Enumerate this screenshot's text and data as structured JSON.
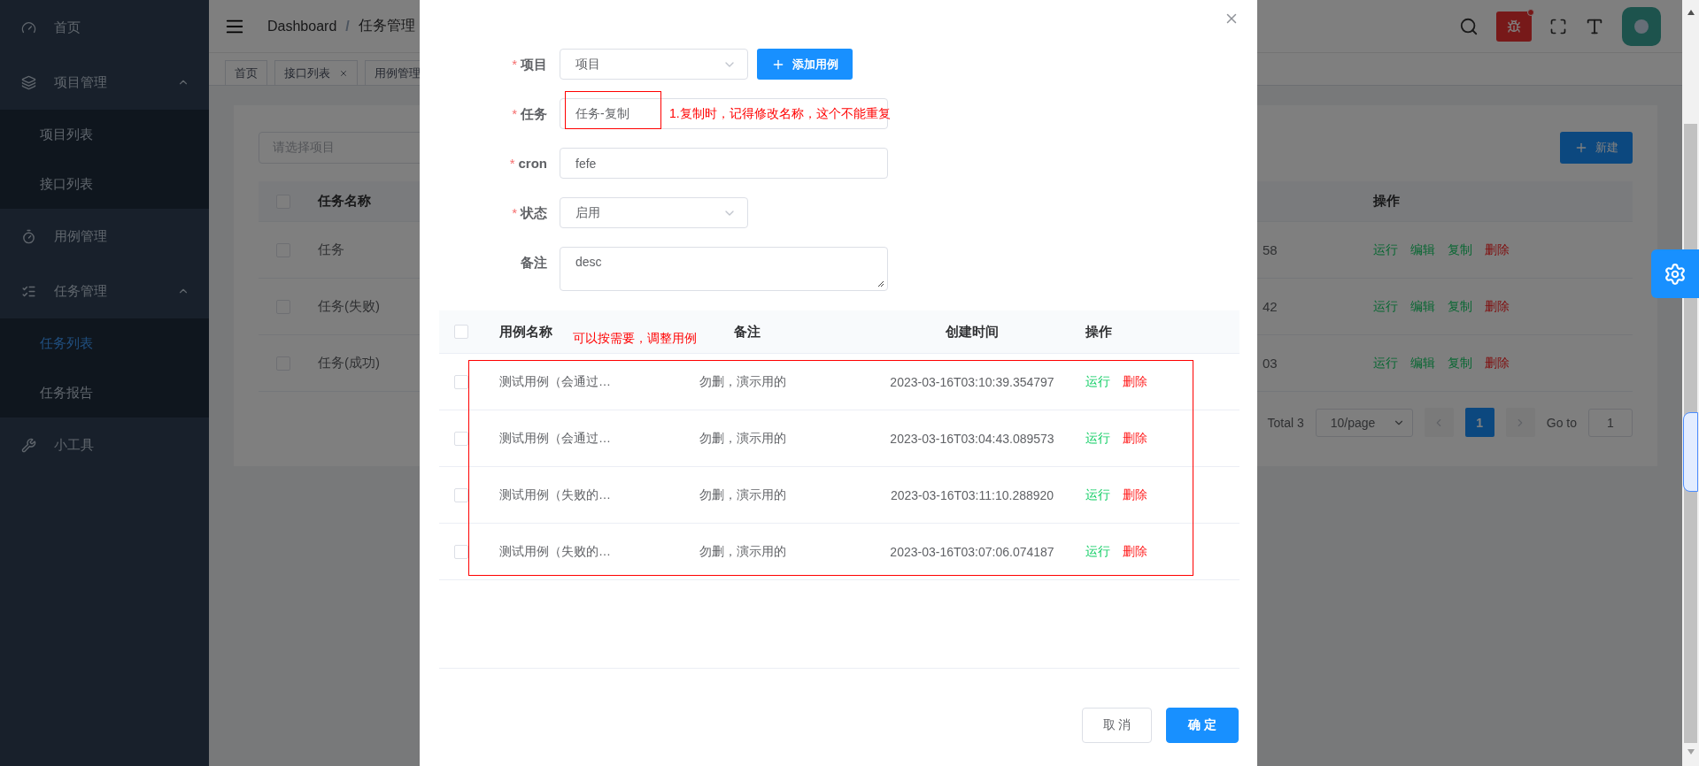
{
  "sidebar": {
    "items": [
      {
        "label": "首页"
      },
      {
        "label": "项目管理",
        "expanded": true,
        "children": [
          {
            "label": "项目列表",
            "selected": false
          },
          {
            "label": "接口列表",
            "selected": false
          }
        ]
      },
      {
        "label": "用例管理"
      },
      {
        "label": "任务管理",
        "expanded": true,
        "children": [
          {
            "label": "任务列表",
            "selected": true
          },
          {
            "label": "任务报告",
            "selected": false
          }
        ]
      },
      {
        "label": "小工具"
      }
    ]
  },
  "header": {
    "breadcrumb": [
      "Dashboard",
      "任务管理"
    ],
    "separator": "/"
  },
  "tags": [
    {
      "label": "首页",
      "closable": false
    },
    {
      "label": "接口列表",
      "closable": true
    },
    {
      "label": "用例管理",
      "closable": false
    }
  ],
  "page": {
    "search_placeholder": "请选择项目",
    "new_button": "新建",
    "table": {
      "columns": [
        "任务名称",
        "操作"
      ],
      "all_checked": false,
      "rows": [
        {
          "name": "任务",
          "checked": false,
          "column_3": "58",
          "actions": [
            {
              "label": "运行",
              "kind": "run"
            },
            {
              "label": "编辑",
              "kind": "edit"
            },
            {
              "label": "复制",
              "kind": "copy"
            },
            {
              "label": "删除",
              "kind": "delete"
            }
          ]
        },
        {
          "name": "任务(失败)",
          "checked": false,
          "column_3": "42",
          "actions": [
            {
              "label": "运行",
              "kind": "run"
            },
            {
              "label": "编辑",
              "kind": "edit"
            },
            {
              "label": "复制",
              "kind": "copy"
            },
            {
              "label": "删除",
              "kind": "delete"
            }
          ]
        },
        {
          "name": "任务(成功)",
          "checked": false,
          "column_3": "03",
          "actions": [
            {
              "label": "运行",
              "kind": "run"
            },
            {
              "label": "编辑",
              "kind": "edit"
            },
            {
              "label": "复制",
              "kind": "copy"
            },
            {
              "label": "删除",
              "kind": "delete"
            }
          ]
        }
      ]
    },
    "pagination": {
      "total": "Total 3",
      "page_size": "10/page",
      "pages": [
        {
          "label": "1",
          "selected": true
        }
      ],
      "goto_label": "Go to",
      "goto_value": "1"
    }
  },
  "modal": {
    "required_mark": "*",
    "fields": [
      {
        "kind": "select",
        "label": "项目",
        "required": true,
        "value": "项目",
        "button": "添加用例"
      },
      {
        "kind": "input",
        "label": "任务",
        "required": true,
        "value": "任务-复制",
        "note": "1.复制时，记得修改名称，这个不能重复"
      },
      {
        "kind": "input",
        "label": "cron",
        "required": true,
        "value": "fefe"
      },
      {
        "kind": "select",
        "label": "状态",
        "required": true,
        "value": "启用"
      },
      {
        "kind": "textarea",
        "label": "备注",
        "required": false,
        "value": "desc"
      }
    ],
    "cases": {
      "columns": [
        "用例名称",
        "备注",
        "创建时间",
        "操作"
      ],
      "note": "可以按需要，调整用例",
      "all_checked": false,
      "rows": [
        {
          "name": "测试用例（会通过…",
          "remark": "勿删，演示用的",
          "created": "2023-03-16T03:10:39.354797",
          "checked": false,
          "actions": [
            {
              "label": "运行",
              "kind": "run"
            },
            {
              "label": "删除",
              "kind": "delete"
            }
          ]
        },
        {
          "name": "测试用例（会通过…",
          "remark": "勿删，演示用的",
          "created": "2023-03-16T03:04:43.089573",
          "checked": false,
          "actions": [
            {
              "label": "运行",
              "kind": "run"
            },
            {
              "label": "删除",
              "kind": "delete"
            }
          ]
        },
        {
          "name": "测试用例（失败的…",
          "remark": "勿删，演示用的",
          "created": "2023-03-16T03:11:10.288920",
          "checked": false,
          "actions": [
            {
              "label": "运行",
              "kind": "run"
            },
            {
              "label": "删除",
              "kind": "delete"
            }
          ]
        },
        {
          "name": "测试用例（失败的…",
          "remark": "勿删，演示用的",
          "created": "2023-03-16T03:07:06.074187",
          "checked": false,
          "actions": [
            {
              "label": "运行",
              "kind": "run"
            },
            {
              "label": "删除",
              "kind": "delete"
            }
          ]
        }
      ]
    },
    "cancel": "取 消",
    "confirm": "确 定"
  }
}
